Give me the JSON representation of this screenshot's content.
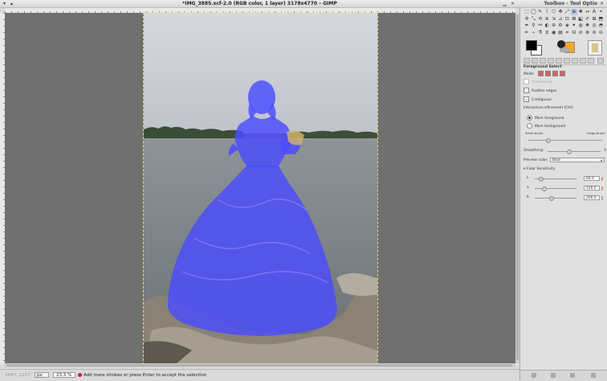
{
  "main_window": {
    "title": "*IMG_3885.xcf-2.0 (RGB color, 1 layer) 3178x4770 – GIMP"
  },
  "toolbox_window": {
    "title": "Toolbox - Tool Optio"
  },
  "statusbar": {
    "coords": "3647, 1257",
    "unit": "px",
    "zoom": "23.3 %",
    "message": "Add more strokes or press Enter to accept the selection"
  },
  "tool_options": {
    "title": "Foreground Select",
    "mode_label": "Mode:",
    "antialiasing": "Antialiasing",
    "feather_edges": "Feather edges",
    "contiguous": "Contiguous",
    "interactive_refinement": "Interactive refinement  (Ctrl)",
    "mark_foreground": "Mark foreground",
    "mark_background": "Mark background",
    "small_brush": "Small brush",
    "large_brush": "Large brush",
    "smoothing_label": "Smoothing:",
    "smoothing_value": 3,
    "preview_color_label": "Preview color:",
    "preview_color": "Blue",
    "color_sensitivity": "Color Sensitivity",
    "sensitivity": [
      {
        "label": "L",
        "value": "64.0",
        "level": 0.25
      },
      {
        "label": "a",
        "value": "128.0",
        "level": 0.5
      },
      {
        "label": "b",
        "value": "256.0",
        "level": 1.0
      }
    ]
  },
  "colors": {
    "selection_overlay": "#4b4cff",
    "canvas_bg": "#707070",
    "fg_color": "#000000",
    "bg_color": "#ffffff"
  }
}
